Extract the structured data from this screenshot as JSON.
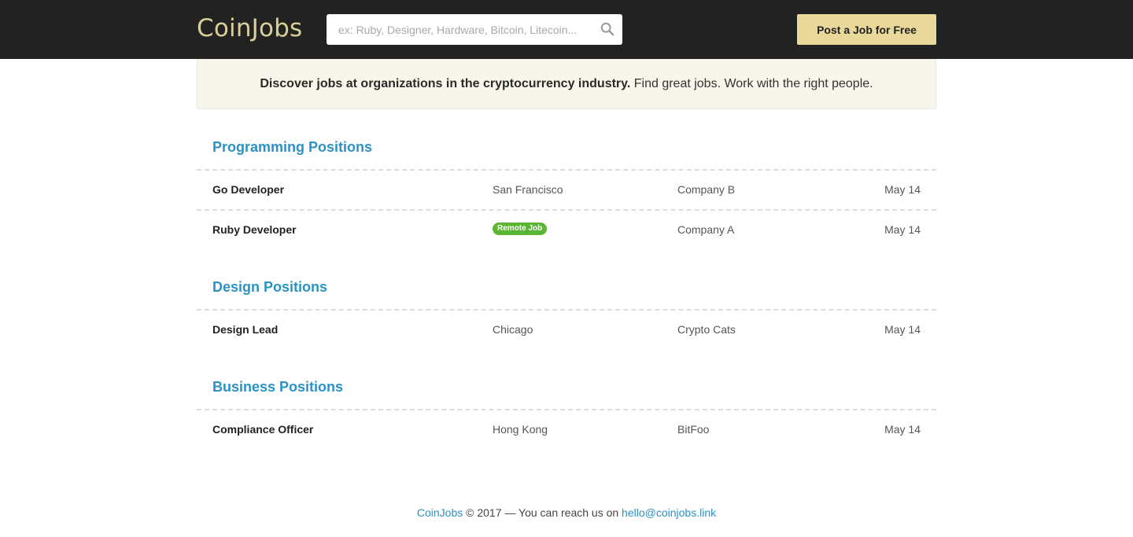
{
  "header": {
    "logo": "CoinJobs",
    "search_placeholder": "ex: Ruby, Designer, Hardware, Bitcoin, Litecoin...",
    "post_button": "Post a Job for Free"
  },
  "intro": {
    "bold": "Discover jobs at organizations in the cryptocurrency industry.",
    "rest": " Find great jobs. Work with the right people."
  },
  "sections": [
    {
      "title": "Programming Positions",
      "jobs": [
        {
          "title": "Go Developer",
          "location": "San Francisco",
          "company": "Company B",
          "date": "May 14"
        },
        {
          "title": "Ruby Developer",
          "location": "Remote Job",
          "company": "Company A",
          "date": "May 14"
        }
      ]
    },
    {
      "title": "Design Positions",
      "jobs": [
        {
          "title": "Design Lead",
          "location": "Chicago",
          "company": "Crypto Cats",
          "date": "May 14"
        }
      ]
    },
    {
      "title": "Business Positions",
      "jobs": [
        {
          "title": "Compliance Officer",
          "location": "Hong Kong",
          "company": "BitFoo",
          "date": "May 14"
        }
      ]
    }
  ],
  "footer": {
    "brand": "CoinJobs",
    "text": " © 2017 — You can reach us on ",
    "email": "hello@coinjobs.link"
  },
  "colors": {
    "topbar": "#222222",
    "logo": "#d9cf98",
    "accent_blue": "#2a92c4",
    "post_button": "#e8d99a",
    "remote_badge": "#5ab532",
    "intro_bg": "#f8f6ea"
  }
}
